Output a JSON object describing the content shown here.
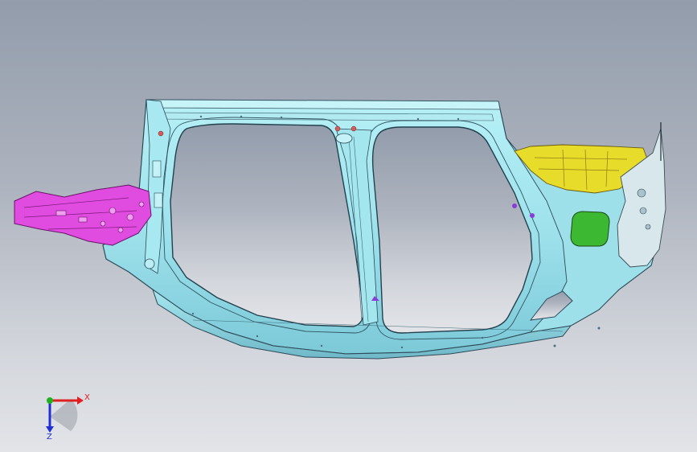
{
  "viewport": {
    "background_top": "#929cab",
    "background_bottom": "#e2e4e8"
  },
  "model": {
    "part": "body-side-assembly",
    "colors": {
      "panel": "#9fe4ec",
      "panel_edge": "#2c4a58",
      "front_rail": "#e04be0",
      "wheelhouse_brace": "#e8dc2a",
      "fuel_door": "#3db833",
      "rear_bracket": "#d7e7ec"
    }
  },
  "triad": {
    "x_label": "X",
    "z_label": "Z",
    "x_color": "#e02020",
    "y_color": "#20b020",
    "z_color": "#2030d0"
  }
}
